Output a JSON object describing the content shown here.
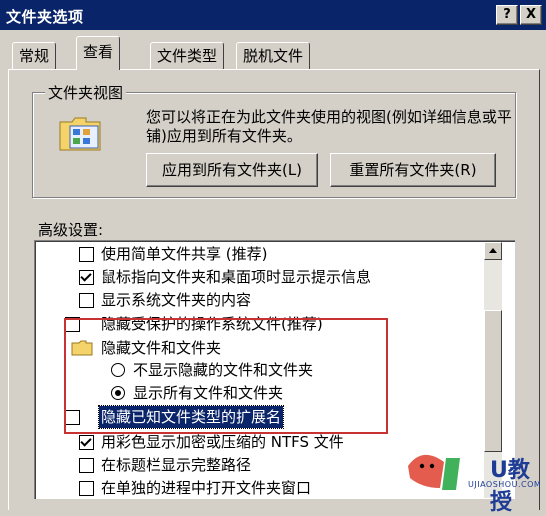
{
  "window": {
    "title": "文件夹选项",
    "help_button": "?",
    "close_button": "X"
  },
  "tabs": [
    {
      "label": "常规",
      "active": false
    },
    {
      "label": "查看",
      "active": true
    },
    {
      "label": "文件类型",
      "active": false
    },
    {
      "label": "脱机文件",
      "active": false
    }
  ],
  "folder_view": {
    "group_title": "文件夹视图",
    "description": "您可以将正在为此文件夹使用的视图(例如详细信息或平铺)应用到所有文件夹。",
    "apply_button": "应用到所有文件夹(L)",
    "reset_button": "重置所有文件夹(R)"
  },
  "advanced": {
    "label": "高级设置:",
    "items": [
      {
        "type": "checkbox",
        "checked": false,
        "label": "使用简单文件共享 (推荐)"
      },
      {
        "type": "checkbox",
        "checked": true,
        "label": "鼠标指向文件夹和桌面项时显示提示信息"
      },
      {
        "type": "checkbox",
        "checked": false,
        "label": "显示系统文件夹的内容"
      },
      {
        "type": "checkbox",
        "checked": false,
        "label": "隐藏受保护的操作系统文件(推荐)"
      },
      {
        "type": "folder",
        "label": "隐藏文件和文件夹"
      },
      {
        "type": "radio",
        "selected": false,
        "label": "不显示隐藏的文件和文件夹"
      },
      {
        "type": "radio",
        "selected": true,
        "label": "显示所有文件和文件夹"
      },
      {
        "type": "checkbox",
        "checked": false,
        "label": "隐藏已知文件类型的扩展名",
        "highlighted": true
      },
      {
        "type": "checkbox",
        "checked": true,
        "label": "用彩色显示加密或压缩的 NTFS 文件"
      },
      {
        "type": "checkbox",
        "checked": false,
        "label": "在标题栏显示完整路径"
      },
      {
        "type": "checkbox",
        "checked": false,
        "label": "在单独的进程中打开文件夹窗口"
      }
    ]
  },
  "watermark": {
    "brand": "U教授",
    "site": "UJIAOSHOU.COM"
  },
  "colors": {
    "titlebar": "#0a246a",
    "face": "#d4d0c8",
    "annotation": "#c83232"
  }
}
